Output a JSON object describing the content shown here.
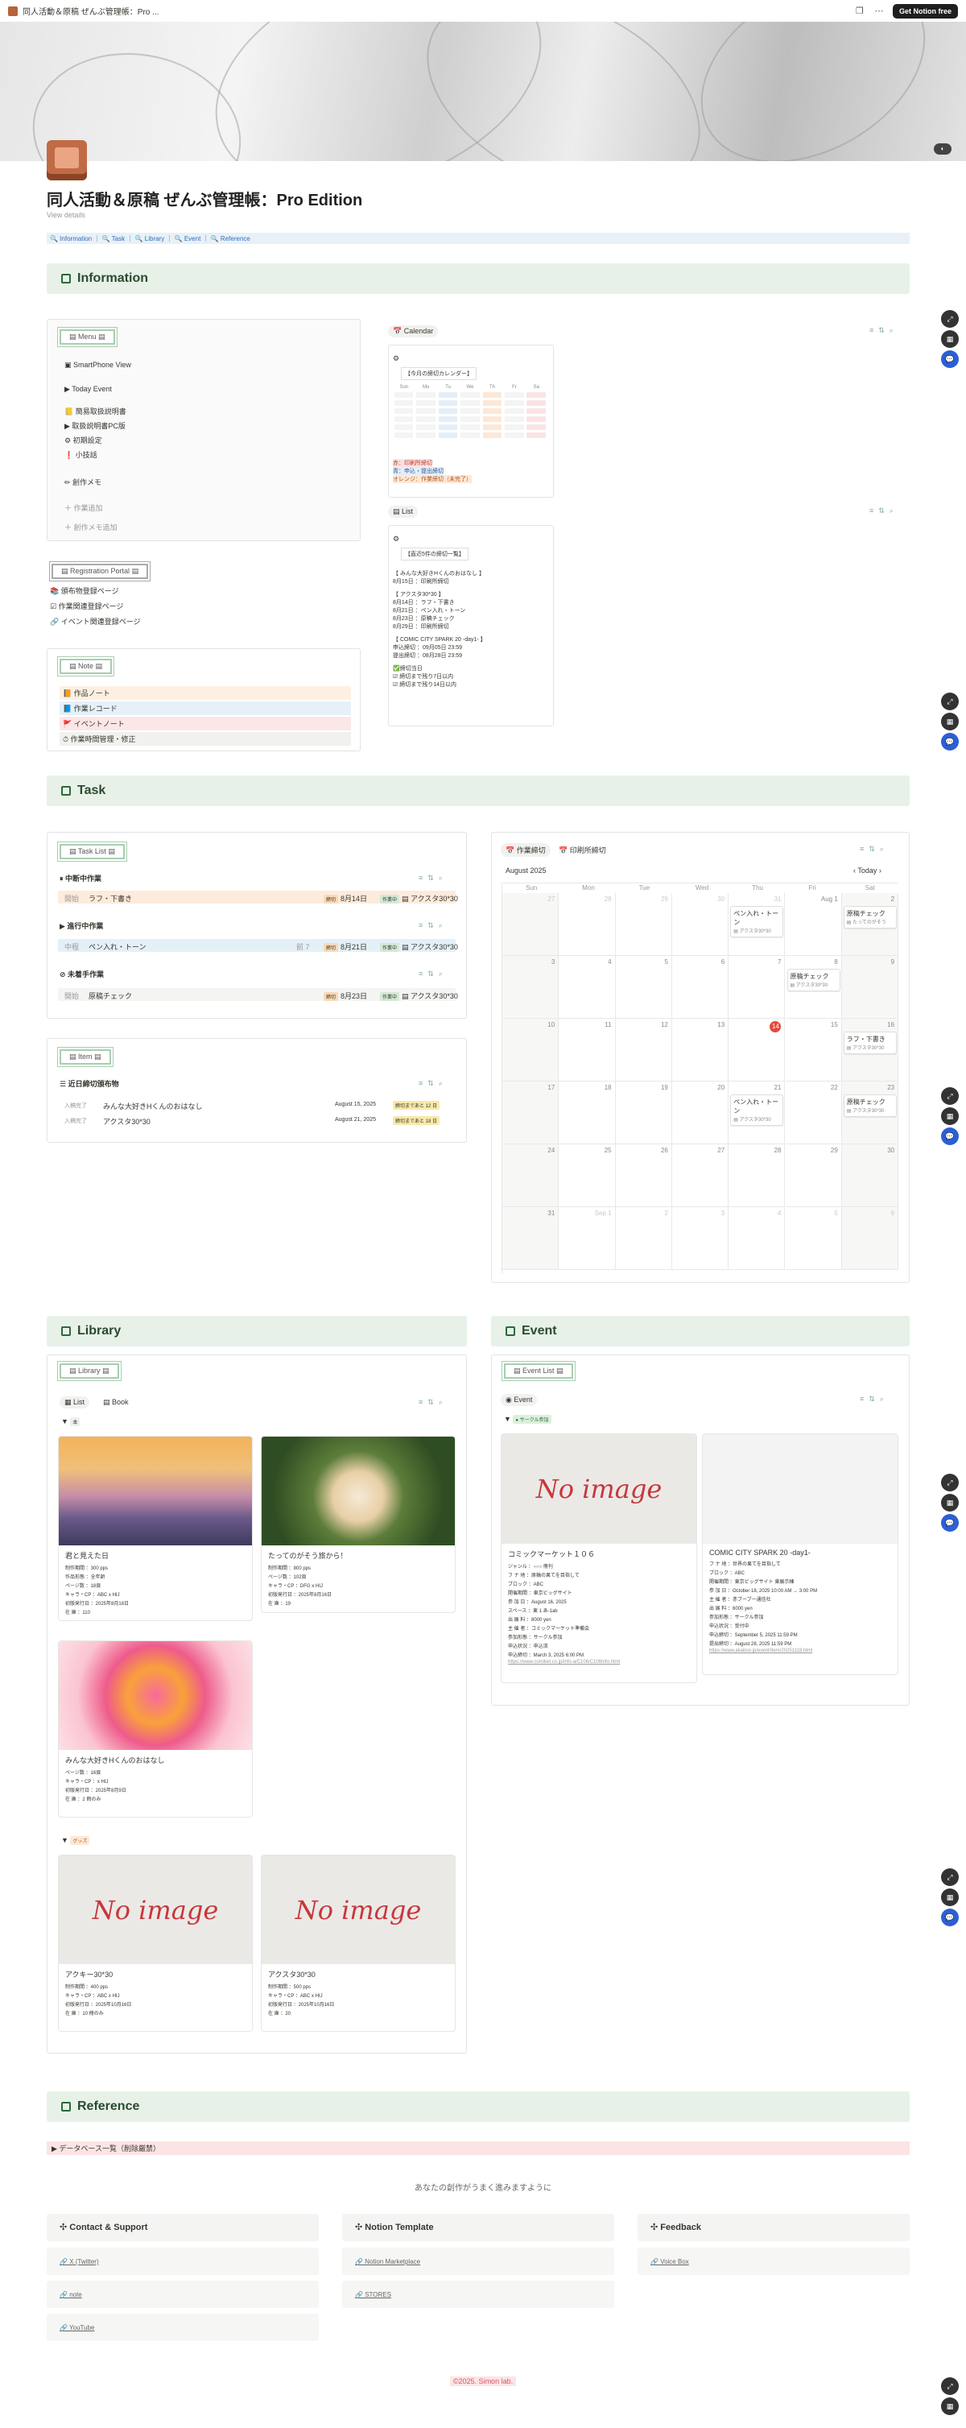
{
  "browser": {
    "tab_title": "同人活動＆原稿 ぜんぶ管理帳：Pro ...",
    "get_notion": "Get Notion free"
  },
  "page": {
    "title": "同人活動＆原稿 ぜんぶ管理帳：Pro Edition",
    "view_details": "View details",
    "nav": "🔍 Information ｜ 🔍 Task ｜ 🔍 Library ｜ 🔍 Event ｜ 🔍 Reference"
  },
  "sections": {
    "information": "Information",
    "task": "Task",
    "library": "Library",
    "event": "Event",
    "reference": "Reference"
  },
  "menu": {
    "title": "Menu",
    "items": [
      "SmartPhone View",
      "Today Event",
      "簡易取扱説明書",
      "取扱説明書PC版",
      "初期設定",
      "小技話",
      "創作メモ",
      "作業追加",
      "創作メモ追加"
    ]
  },
  "registration": {
    "title": "Registration Portal",
    "items": [
      "頒布物登録ページ",
      "作業関連登録ページ",
      "イベント関連登録ページ"
    ]
  },
  "note": {
    "title": "Note",
    "items": [
      "作品ノート",
      "作業レコード",
      "イベントノート",
      "作業時間管理・修正"
    ]
  },
  "calendar_box": {
    "title": "Calendar",
    "head": "【今月の締切カレンダー】",
    "weekdays": [
      "Sun",
      "Mo",
      "Tu",
      "We",
      "Th",
      "Fr",
      "Sa"
    ],
    "legend": [
      "赤：印刷所締切",
      "青：申込・提出締切",
      "オレンジ：作業締切（未完了）"
    ]
  },
  "list_box": {
    "title": "List",
    "head": "【直近5件の締切一覧】",
    "lines": [
      "【 みんな大好きHくんのおはなし 】",
      "8月15日 ：印刷所締切",
      "【 アクスタ30*30 】",
      "8月14日 ：ラフ・下書き",
      "8月21日 ：ペン入れ・トーン",
      "8月23日 ：原稿チェック",
      "8月29日 ：印刷所締切",
      "【 COMIC CITY SPARK 20 -day1- 】",
      "申込締切 ：09月05日 23:59",
      "提出締切 ：08月28日 23:59",
      "✅締切当日",
      "☑ 締切まで残り7日以内",
      "☑ 締切まで残り14日以内"
    ]
  },
  "task_list": {
    "title": "Task List",
    "groups": [
      {
        "name": "中断中作業",
        "rows": [
          {
            "status": "開始",
            "name": "ラフ・下書き",
            "date": "8月14日",
            "cat": "アクスタ30*30"
          }
        ]
      },
      {
        "name": "進行中作業",
        "rows": [
          {
            "status": "中程",
            "name": "ペン入れ・トーン",
            "extra": "前 7",
            "date": "8月21日",
            "cat": "アクスタ30*30"
          }
        ]
      },
      {
        "name": "未着手作業",
        "rows": [
          {
            "status": "開始",
            "name": "原稿チェック",
            "date": "8月23日",
            "cat": "アクスタ30*30"
          }
        ]
      }
    ]
  },
  "item_list": {
    "title": "Item",
    "group": "近日締切頒布物",
    "rows": [
      {
        "status": "入稿完了",
        "name": "みんな大好きHくんのおはなし",
        "date": "August 15, 2025",
        "badge": "締切まであと 12 日"
      },
      {
        "status": "入稿完了",
        "name": "アクスタ30*30",
        "date": "August 21, 2025",
        "badge": "締切まであと 18 日"
      }
    ]
  },
  "task_calendar": {
    "tabs": [
      "作業締切",
      "印刷所締切"
    ],
    "month": "August 2025",
    "today": "Today",
    "weekdays": [
      "Sun",
      "Mon",
      "Tue",
      "Wed",
      "Thu",
      "Fri",
      "Sat"
    ],
    "days": [
      "27",
      "28",
      "29",
      "30",
      "31",
      "Aug 1",
      "2",
      "3",
      "4",
      "5",
      "6",
      "7",
      "8",
      "9",
      "10",
      "11",
      "12",
      "13",
      "14",
      "15",
      "16",
      "17",
      "18",
      "19",
      "20",
      "21",
      "22",
      "23",
      "24",
      "25",
      "26",
      "27",
      "28",
      "29",
      "30",
      "31",
      "Sep 1",
      "2",
      "3",
      "4",
      "5",
      "6"
    ],
    "events": [
      {
        "name": "ペン入れ・トーン",
        "sub": "アクスタ30*30"
      },
      {
        "name": "原稿チェック",
        "sub": "たってのがそう"
      },
      {
        "name": "原稿チェック",
        "sub": "アクスタ30*30"
      },
      {
        "name": "ラフ・下書き",
        "sub": "アクスタ30*30"
      },
      {
        "name": "ペン入れ・トーン",
        "sub": "アクスタ30*30"
      },
      {
        "name": "原稿チェック",
        "sub": "アクスタ30*30"
      }
    ]
  },
  "library": {
    "title": "Library",
    "tabs": [
      "List",
      "Book"
    ],
    "group_books": "本",
    "group_goods": "グッズ",
    "no_image": "No image",
    "cards": [
      {
        "name": "君と見えた日",
        "props": [
          "制作期間 ：300 pps",
          "作品形態 ：全年齢",
          "ページ数 ：18頁",
          "キャラ・CP ：ABC x HIJ",
          "初版発行日 ：2025年8月18日",
          "在 庫 ：110"
        ]
      },
      {
        "name": "たってのがそう旅から！",
        "props": [
          "制作期間 ：800 pps",
          "ページ数 ：102頁",
          "キャラ・CP ：DFG x HIJ",
          "初版発行日 ：2025年8月16日",
          "在 庫 ：19"
        ]
      },
      {
        "name": "みんな大好きHくんのおはなし",
        "props": [
          "ページ数 ：16頁",
          "キャラ・CP ：x HIJ",
          "初版発行日 ：2025年8月9日",
          "在 庫 ：2 冊のみ"
        ]
      },
      {
        "name": "アクキー30*30",
        "props": [
          "制作期間 ：400 pps",
          "キャラ・CP ：ABC x HIJ",
          "初版発行日 ：2025年10月16日",
          "在 庫 ：10 冊のみ"
        ]
      },
      {
        "name": "アクスタ30*30",
        "props": [
          "制作期間 ：500 pps",
          "キャラ・CP ：ABC x HIJ",
          "初版発行日 ：2025年10月16日",
          "在 庫 ：20"
        ]
      }
    ]
  },
  "event": {
    "title": "Event List",
    "tab": "Event",
    "group": "サークル参加",
    "no_image": "No image",
    "cards": [
      {
        "name": "コミックマーケット１０６",
        "props": [
          "ジャンル ：○○○ 冊刊",
          "フ ナ 地 ：原稿の果てを目指して",
          "ブロック ：ABC",
          "開催期間 ：東京ビッグサイト",
          "参 加 日 ：August 16, 2025",
          "スペース ：東 1 あ-1ab",
          "出 展 料 ：8000 yen",
          "主 催 者 ：コミックマーケット準備会",
          "参加形態 ：サークル参加",
          "申込状況 ：申込済",
          "申込締切 ：March 3, 2025 6:00 PM"
        ],
        "url": "https://www.comiket.co.jp/info-a/C106/C106Info.html"
      },
      {
        "name": "COMIC CITY SPARK 20 -day1-",
        "props": [
          "フ ナ 地 ：世界の果てを目指して",
          "ブロック ：ABC",
          "開催期間 ：東京ビッグサイト 東展示棟",
          "参 加 日 ：October 18, 2025 10:00 AM → 3:00 PM",
          "主 催 者 ：赤ブーブー通信社",
          "出 展 料 ：6000 yen",
          "参加形態 ：サークル参加",
          "申込状況 ：受付中",
          "申込締切 ：September 5, 2025 11:59 PM",
          "提出締切 ：August 28, 2025 11:59 PM"
        ],
        "url": "https://www.akaboo.jp/event/item/20251118.html"
      }
    ]
  },
  "reference": {
    "toggle": "データベース一覧（削除厳禁）",
    "tagline": "あなたの創作がうまく進みますように",
    "cols": [
      {
        "title": "Contact & Support",
        "links": [
          "X (Twitter)",
          "note",
          "YouTube"
        ]
      },
      {
        "title": "Notion Template",
        "links": [
          "Notion Marketplace",
          "STORES"
        ]
      },
      {
        "title": "Feedback",
        "links": [
          "Voice Box"
        ]
      }
    ],
    "copyright": "©2025. Simon lab."
  },
  "colors": {
    "section_bg": "#e7f1e8",
    "accent_green": "#2b6a38",
    "nav_blue": "#2f6fb5",
    "today_red": "#e34a3b"
  }
}
